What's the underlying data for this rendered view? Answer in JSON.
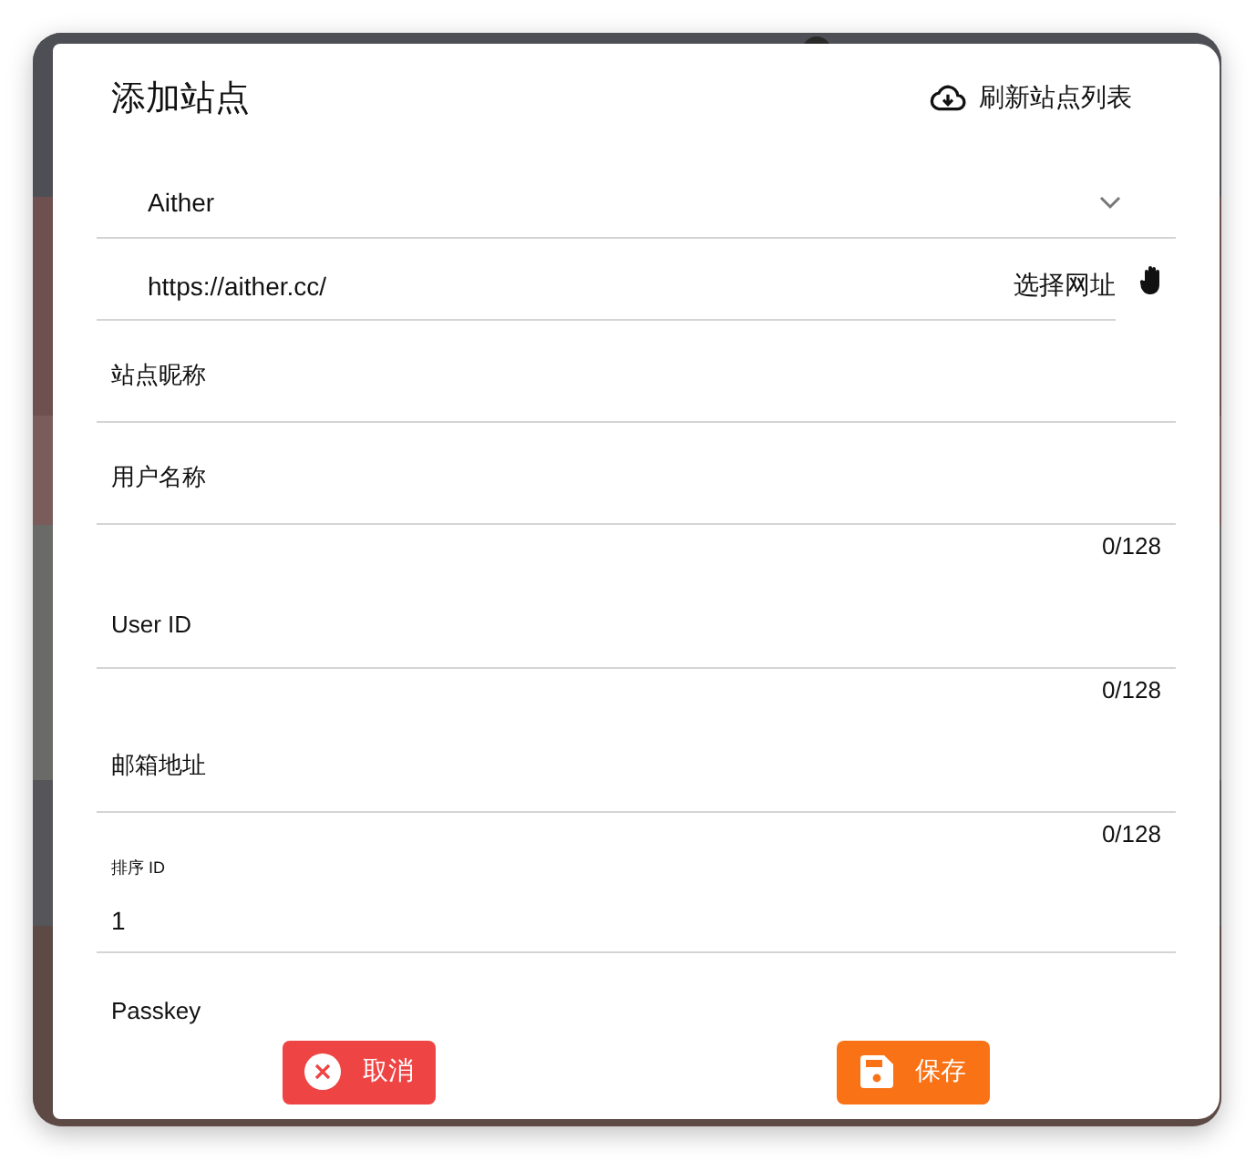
{
  "dialog": {
    "title": "添加站点",
    "refresh_button": {
      "label": "刷新站点列表"
    },
    "site_select": {
      "value": "Aither"
    },
    "url_field": {
      "value": "https://aither.cc/",
      "button": "选择网址"
    },
    "fields": [
      {
        "label": "站点昵称"
      },
      {
        "label": "用户名称",
        "counter": "0/128"
      },
      {
        "label": "User ID",
        "counter": "0/128"
      },
      {
        "label": "邮箱地址",
        "counter": "0/128"
      },
      {
        "label": "排序 ID",
        "value": "1"
      },
      {
        "label": "Passkey"
      }
    ],
    "buttons": [
      {
        "kind": "cancel",
        "label": "取消"
      },
      {
        "kind": "save",
        "label": "保存"
      }
    ]
  }
}
